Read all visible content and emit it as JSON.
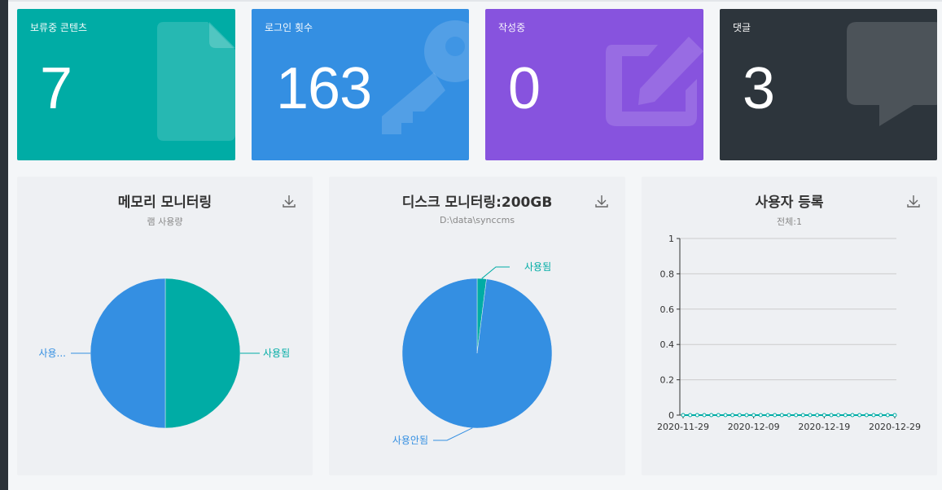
{
  "cards": [
    {
      "label": "보류중 콘텐츠",
      "value": "7",
      "color": "#00aca5",
      "icon": "document-icon"
    },
    {
      "label": "로그인 횟수",
      "value": "163",
      "color": "#348fe2",
      "icon": "key-icon"
    },
    {
      "label": "작성중",
      "value": "0",
      "color": "#8753de",
      "icon": "edit-icon"
    },
    {
      "label": "댓글",
      "value": "3",
      "color": "#2d353c",
      "icon": "comment-icon"
    }
  ],
  "panels": {
    "memory": {
      "title": "메모리 모니터링",
      "subtitle": "램 사용량"
    },
    "disk": {
      "title": "디스크 모니터링:200GB",
      "subtitle": "D:\\data\\synccms"
    },
    "users": {
      "title": "사용자 등록",
      "subtitle": "전체:1"
    }
  },
  "chart_data": [
    {
      "type": "pie",
      "title": "메모리 모니터링",
      "subtitle": "램 사용량",
      "slices": [
        {
          "label": "사용됨",
          "value": 50,
          "color": "#00aca5"
        },
        {
          "label": "사용...",
          "value": 50,
          "color": "#348fe2"
        }
      ]
    },
    {
      "type": "pie",
      "title": "디스크 모니터링:200GB",
      "subtitle": "D:\\data\\synccms",
      "slices": [
        {
          "label": "사용됨",
          "value": 2,
          "color": "#00aca5"
        },
        {
          "label": "사용안됨",
          "value": 98,
          "color": "#348fe2"
        }
      ]
    },
    {
      "type": "line",
      "title": "사용자 등록",
      "subtitle": "전체:1",
      "ylim": [
        0,
        1
      ],
      "yticks": [
        "0",
        "0.2",
        "0.4",
        "0.6",
        "0.8",
        "1"
      ],
      "xticks": [
        "2020-11-29",
        "2020-12-09",
        "2020-12-19",
        "2020-12-29"
      ],
      "x_start": "2020-11-29",
      "x_end": "2020-12-29",
      "values": [
        0,
        0,
        0,
        0,
        0,
        0,
        0,
        0,
        0,
        0,
        0,
        0,
        0,
        0,
        0,
        0,
        0,
        0,
        0,
        0,
        0,
        0,
        0,
        0,
        0,
        0,
        0,
        0,
        0,
        0,
        0
      ],
      "color": "#00aca5",
      "grid": true
    }
  ]
}
